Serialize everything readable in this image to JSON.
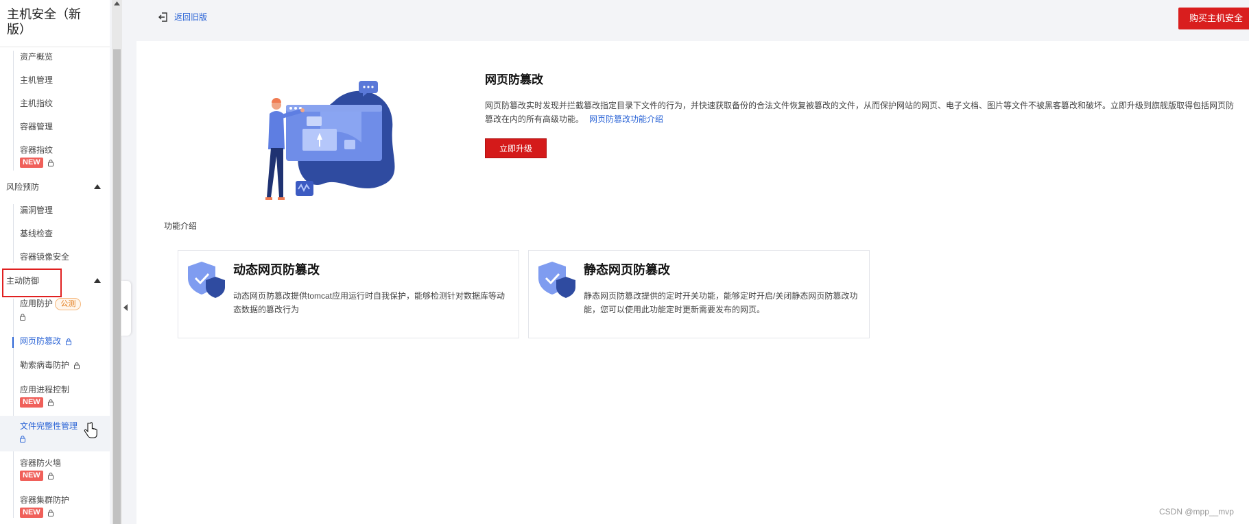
{
  "sidebar": {
    "title": "主机安全（新版）",
    "items_top": [
      {
        "label": "资产概览"
      },
      {
        "label": "主机管理"
      },
      {
        "label": "主机指纹"
      },
      {
        "label": "容器管理"
      },
      {
        "label": "容器指纹",
        "badge": "NEW"
      }
    ],
    "group_risk": "风险预防",
    "items_risk": [
      {
        "label": "漏洞管理"
      },
      {
        "label": "基线检查"
      },
      {
        "label": "容器镜像安全"
      }
    ],
    "group_defense": "主动防御",
    "items_defense": [
      {
        "label": "应用防护",
        "badge": "公测"
      },
      {
        "label": "网页防篡改"
      },
      {
        "label": "勒索病毒防护"
      },
      {
        "label": "应用进程控制",
        "badge": "NEW"
      },
      {
        "label": "文件完整性管理"
      },
      {
        "label": "容器防火墙",
        "badge": "NEW"
      },
      {
        "label": "容器集群防护",
        "badge": "NEW"
      }
    ]
  },
  "topbar": {
    "back_label": "返回旧版",
    "buy_label": "购买主机安全"
  },
  "hero": {
    "title": "网页防篡改",
    "description": "网页防篡改实时发现并拦截篡改指定目录下文件的行为，并快速获取备份的合法文件恢复被篡改的文件，从而保护网站的网页、电子文档、图片等文件不被黑客篡改和破坏。立即升级到旗舰版取得包括网页防篡改在内的所有高级功能。",
    "link": "网页防篡改功能介绍",
    "upgrade_label": "立即升级"
  },
  "features": {
    "section_label": "功能介绍",
    "cards": [
      {
        "title": "动态网页防篡改",
        "desc": "动态网页防篡改提供tomcat应用运行时自我保护，能够检测针对数据库等动态数据的篡改行为"
      },
      {
        "title": "静态网页防篡改",
        "desc": "静态网页防篡改提供的定时开关功能，能够定时开启/关闭静态网页防篡改功能，您可以使用此功能定时更新需要发布的网页。"
      }
    ]
  },
  "watermark": "CSDN @mpp__mvp",
  "colors": {
    "brand_red": "#d91e1e",
    "link_blue": "#2b64d6",
    "badge_new": "#f0605a"
  }
}
